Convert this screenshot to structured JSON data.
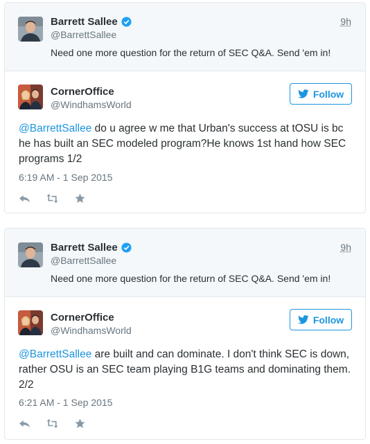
{
  "cards": [
    {
      "parent": {
        "name": "Barrett Sallee",
        "handle": "@BarrettSallee",
        "time": "9h",
        "text": "Need one more question for the return of SEC Q&A. Send 'em in!"
      },
      "tweet": {
        "name": "CornerOffice",
        "handle": "@WindhamsWorld",
        "follow_label": "Follow",
        "mention": "@BarrettSallee",
        "text": " do u agree w me that Urban's success at tOSU is bc he has built an SEC modeled program?He knows 1st hand how SEC programs 1/2",
        "date": "6:19 AM - 1 Sep 2015"
      }
    },
    {
      "parent": {
        "name": "Barrett Sallee",
        "handle": "@BarrettSallee",
        "time": "9h",
        "text": "Need one more question for the return of SEC Q&A. Send 'em in!"
      },
      "tweet": {
        "name": "CornerOffice",
        "handle": "@WindhamsWorld",
        "follow_label": "Follow",
        "mention": "@BarrettSallee",
        "text": " are built and can dominate. I don't think SEC is down, rather OSU is an SEC team playing B1G teams and dominating them. 2/2",
        "date": "6:21 AM - 1 Sep 2015"
      }
    }
  ],
  "icons": {
    "verified": "verified-badge-icon",
    "follow": "twitter-bird-icon",
    "reply": "reply-icon",
    "retweet": "retweet-icon",
    "favorite": "favorite-star-icon"
  },
  "colors": {
    "link": "#1b95e0",
    "secondary": "#66757f",
    "border": "#e1e8ed",
    "parent_bg": "#f5f8fa"
  }
}
